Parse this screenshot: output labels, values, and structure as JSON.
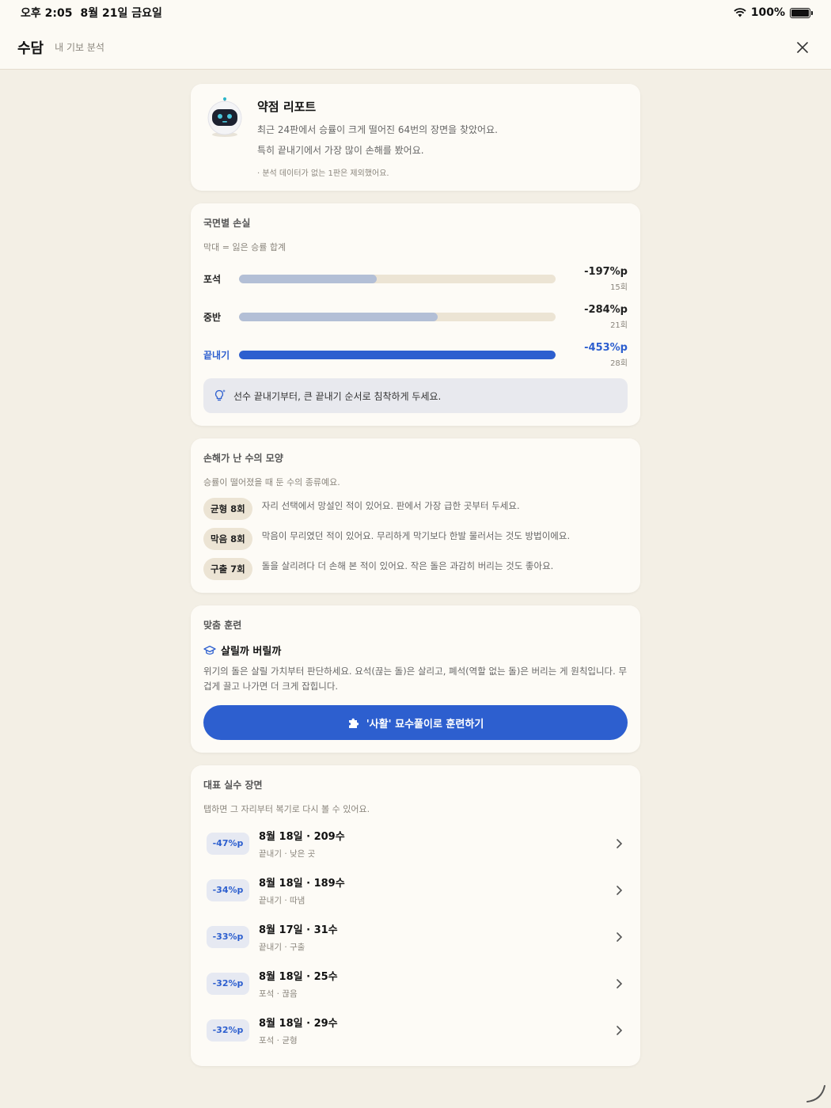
{
  "status": {
    "time": "오후 2:05",
    "date": "8월 21일 금요일",
    "battery": "100%",
    "battery_level": 1.0
  },
  "header": {
    "title": "수담",
    "subtitle": "내 기보 분석"
  },
  "report": {
    "title": "약점 리포트",
    "line1": "최근 24판에서 승률이 크게 떨어진 64번의 장면을 찾았어요.",
    "line2": "특히 끝내기에서 가장 많이 손해를 봤어요.",
    "note": "· 분석 데이터가 없는 1판은 제외했어요."
  },
  "phases": {
    "title": "국면별 손실",
    "subtitle": "막대 = 잃은 승률 합계",
    "items": [
      {
        "label": "포석",
        "pct": "-197%p",
        "count": "15회",
        "value": 197,
        "accent": false
      },
      {
        "label": "중반",
        "pct": "-284%p",
        "count": "21회",
        "value": 284,
        "accent": false
      },
      {
        "label": "끝내기",
        "pct": "-453%p",
        "count": "28회",
        "value": 453,
        "accent": true
      }
    ],
    "max": 453,
    "tip": "선수 끝내기부터, 큰 끝내기 순서로 침착하게 두세요."
  },
  "patterns": {
    "title": "손해가 난 수의 모양",
    "subtitle": "승률이 떨어졌을 때 둔 수의 종류예요.",
    "items": [
      {
        "pill": "균형 8회",
        "desc": "자리 선택에서 망설인 적이 있어요. 판에서 가장 급한 곳부터 두세요."
      },
      {
        "pill": "막음 8회",
        "desc": "막음이 무리였던 적이 있어요. 무리하게 막기보다 한발 물러서는 것도 방법이에요."
      },
      {
        "pill": "구출 7회",
        "desc": "돌을 살리려다 더 손해 본 적이 있어요. 작은 돌은 과감히 버리는 것도 좋아요."
      }
    ]
  },
  "training": {
    "title": "맞춤 훈련",
    "name": "살릴까 버릴까",
    "desc": "위기의 돌은 살릴 가치부터 판단하세요. 요석(끊는 돌)은 살리고, 폐석(역할 없는 돌)은 버리는 게 원칙입니다. 무겁게 끌고 나가면 더 크게 잡힙니다.",
    "button": "'사활' 묘수풀이로 훈련하기"
  },
  "mistakes": {
    "title": "대표 실수 장면",
    "subtitle": "탭하면 그 자리부터 복기로 다시 볼 수 있어요.",
    "items": [
      {
        "badge": "-47%p",
        "title": "8월 18일 · 209수",
        "sub": "끝내기 · 낮은 곳"
      },
      {
        "badge": "-34%p",
        "title": "8월 18일 · 189수",
        "sub": "끝내기 · 따냄"
      },
      {
        "badge": "-33%p",
        "title": "8월 17일 · 31수",
        "sub": "끝내기 · 구출"
      },
      {
        "badge": "-32%p",
        "title": "8월 18일 · 25수",
        "sub": "포석 · 끊음"
      },
      {
        "badge": "-32%p",
        "title": "8월 18일 · 29수",
        "sub": "포석 · 균형"
      }
    ]
  },
  "colors": {
    "accent": "#2d5fcf",
    "background": "#f3efe5",
    "card": "#fdfbf6",
    "bar_inactive": "#b3bfd6",
    "track": "#ece4d4"
  }
}
